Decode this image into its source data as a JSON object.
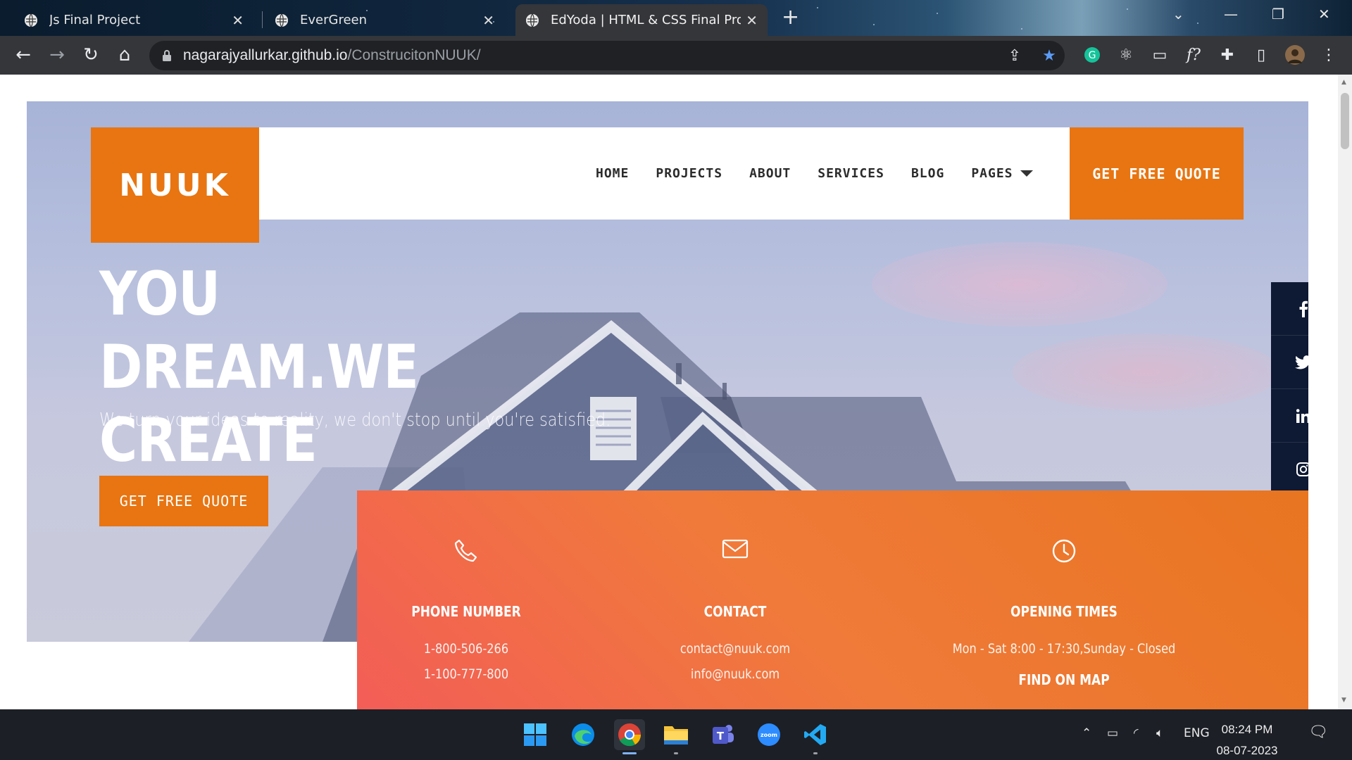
{
  "browser": {
    "tabs": [
      {
        "title": "Js Final Project",
        "active": false
      },
      {
        "title": "EverGreen",
        "active": false
      },
      {
        "title": "EdYoda | HTML & CSS Final Proje",
        "active": true
      }
    ],
    "url_host": "nagarajyallurkar.github.io",
    "url_path": "/ConstrucitonNUUK/"
  },
  "site": {
    "logo": "NUUK",
    "nav": [
      {
        "label": "HOME"
      },
      {
        "label": "PROJECTS"
      },
      {
        "label": "ABOUT"
      },
      {
        "label": "SERVICES"
      },
      {
        "label": "BLOG"
      },
      {
        "label": "PAGES",
        "has_dropdown": true
      }
    ],
    "cta_top": "GET FREE QUOTE",
    "hero": {
      "headline": "YOU DREAM.WE CREATE",
      "subtitle": "We turn your ideas to reality, we don't stop until you're satisfied.",
      "cta": "GET FREE QUOTE"
    },
    "social": [
      "facebook-icon",
      "twitter-icon",
      "linkedin-icon",
      "instagram-icon"
    ],
    "info": {
      "phone": {
        "title": "PHONE NUMBER",
        "lines": [
          "1-800-506-266",
          "1-100-777-800"
        ]
      },
      "contact": {
        "title": "CONTACT",
        "lines": [
          "contact@nuuk.com",
          "info@nuuk.com"
        ]
      },
      "hours": {
        "title": "OPENING TIMES",
        "lines": [
          "Mon - Sat 8:00 - 17:30,Sunday - Closed"
        ],
        "link": "FIND ON MAP"
      }
    },
    "colors": {
      "accent": "#e87511",
      "dark": "#0e1933"
    }
  },
  "taskbar": {
    "apps": [
      "windows-start",
      "edge",
      "chrome",
      "file-explorer",
      "teams",
      "zoom",
      "vscode"
    ],
    "language": "ENG",
    "time": "08:24 PM",
    "date": "08-07-2023"
  }
}
